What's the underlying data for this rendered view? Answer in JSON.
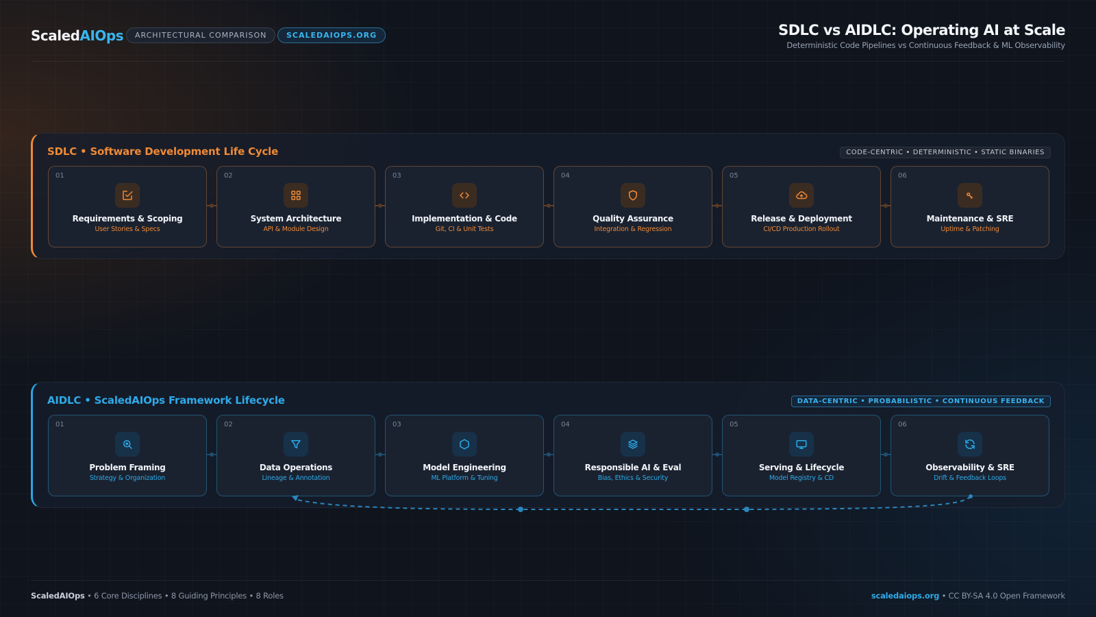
{
  "header": {
    "brand_part1": "Scaled",
    "brand_part2": "AIOps",
    "pill_comparison": "ARCHITECTURAL COMPARISON",
    "pill_site": "SCALEDAIOPS.ORG",
    "title": "SDLC vs AIDLC: Operating AI at Scale",
    "subtitle": "Deterministic Code Pipelines vs Continuous Feedback & ML Observability"
  },
  "sdlc": {
    "title": "SDLC • Software Development Life Cycle",
    "tag": "CODE-CENTRIC • DETERMINISTIC • STATIC BINARIES",
    "accent": "#f08a36",
    "stages": [
      {
        "num": "01",
        "title": "Requirements & Scoping",
        "sub": "User Stories & Specs",
        "icon": "checkbox-edit-icon"
      },
      {
        "num": "02",
        "title": "System Architecture",
        "sub": "API & Module Design",
        "icon": "grid-icon"
      },
      {
        "num": "03",
        "title": "Implementation & Code",
        "sub": "Git, CI & Unit Tests",
        "icon": "code-icon"
      },
      {
        "num": "04",
        "title": "Quality Assurance",
        "sub": "Integration & Regression",
        "icon": "shield-icon"
      },
      {
        "num": "05",
        "title": "Release & Deployment",
        "sub": "CI/CD Production Rollout",
        "icon": "cloud-upload-icon"
      },
      {
        "num": "06",
        "title": "Maintenance & SRE",
        "sub": "Uptime & Patching",
        "icon": "key-icon"
      }
    ]
  },
  "aidlc": {
    "title": "AIDLC • ScaledAIOps Framework Lifecycle",
    "tag": "DATA-CENTRIC • PROBABILISTIC • CONTINUOUS FEEDBACK",
    "accent": "#2eaae8",
    "stages": [
      {
        "num": "01",
        "title": "Problem Framing",
        "sub": "Strategy & Organization",
        "icon": "search-icon"
      },
      {
        "num": "02",
        "title": "Data Operations",
        "sub": "Lineage & Annotation",
        "icon": "filter-icon"
      },
      {
        "num": "03",
        "title": "Model Engineering",
        "sub": "ML Platform & Tuning",
        "icon": "hexagon-icon"
      },
      {
        "num": "04",
        "title": "Responsible AI & Eval",
        "sub": "Bias, Ethics & Security",
        "icon": "layers-icon"
      },
      {
        "num": "05",
        "title": "Serving & Lifecycle",
        "sub": "Model Registry & CD",
        "icon": "monitor-icon"
      },
      {
        "num": "06",
        "title": "Observability & SRE",
        "sub": "Drift & Feedback Loops",
        "icon": "refresh-icon"
      }
    ]
  },
  "footer": {
    "brand": "ScaledAIOps",
    "stats": " • 6 Core Disciplines • 8 Guiding Principles • 8 Roles",
    "link": "scaledaiops.org",
    "license": " • CC BY-SA 4.0 Open Framework"
  }
}
